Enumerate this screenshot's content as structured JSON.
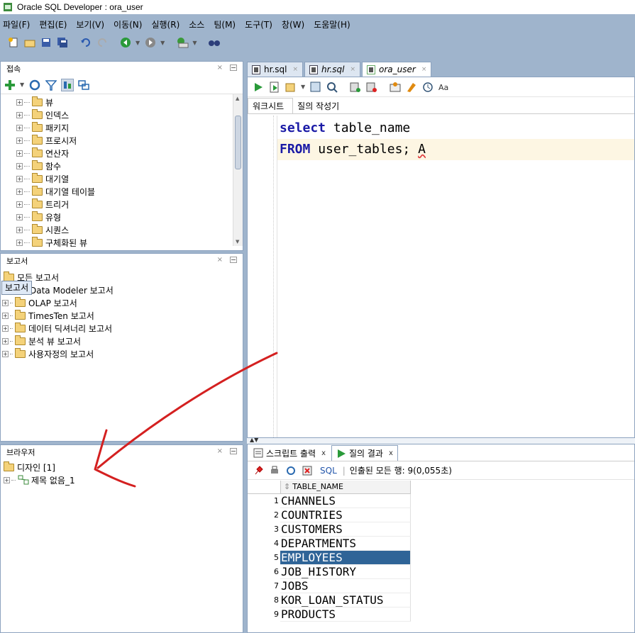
{
  "window": {
    "title": "Oracle SQL Developer : ora_user"
  },
  "menu": [
    "파일(F)",
    "편집(E)",
    "보기(V)",
    "이동(N)",
    "실행(R)",
    "소스",
    "팀(M)",
    "도구(T)",
    "창(W)",
    "도움말(H)"
  ],
  "connections_panel": {
    "title": "접속",
    "items": [
      "뷰",
      "인덱스",
      "패키지",
      "프로시저",
      "연산자",
      "함수",
      "대기열",
      "대기열 테이블",
      "트리거",
      "유형",
      "시퀀스",
      "구체화된 뷰"
    ]
  },
  "reports_panel": {
    "title": "보고서",
    "tooltip": "보고서",
    "items": [
      "모든 보고서",
      "Data Modeler 보고서",
      "OLAP 보고서",
      "TimesTen 보고서",
      "데이터 딕셔너리 보고서",
      "분석 뷰 보고서",
      "사용자정의 보고서"
    ]
  },
  "browser_panel": {
    "title": "브라우저",
    "root": "디자인 [1]",
    "child": "제목 없음_1"
  },
  "editor_tabs": [
    {
      "label": "hr.sql",
      "italic": false
    },
    {
      "label": "hr.sql",
      "italic": true
    },
    {
      "label": "ora_user",
      "italic": true
    }
  ],
  "subtabs": {
    "worksheet": "워크시트",
    "query_builder": "질의 작성기"
  },
  "code": {
    "line1_kw": "select",
    "line1_rest": " table_name",
    "line2_kw": "FROM",
    "line2_rest": " user_tables; ",
    "line2_err": "A"
  },
  "results": {
    "tab_script": "스크립트 출력",
    "tab_query": "질의 결과",
    "sql_label": "SQL",
    "status": "인출된 모든 행: 9(0,055초)",
    "column": "TABLE_NAME",
    "rows": [
      "CHANNELS",
      "COUNTRIES",
      "CUSTOMERS",
      "DEPARTMENTS",
      "EMPLOYEES",
      "JOB_HISTORY",
      "JOBS",
      "KOR_LOAN_STATUS",
      "PRODUCTS"
    ],
    "row_numbers": [
      "1",
      "2",
      "3",
      "4",
      "5",
      "6",
      "7",
      "8",
      "9"
    ],
    "selected_row": 5
  },
  "colors": {
    "accent": "#2f6497",
    "keyword": "#1a1aa6",
    "annotation_arrow": "#d42020"
  }
}
